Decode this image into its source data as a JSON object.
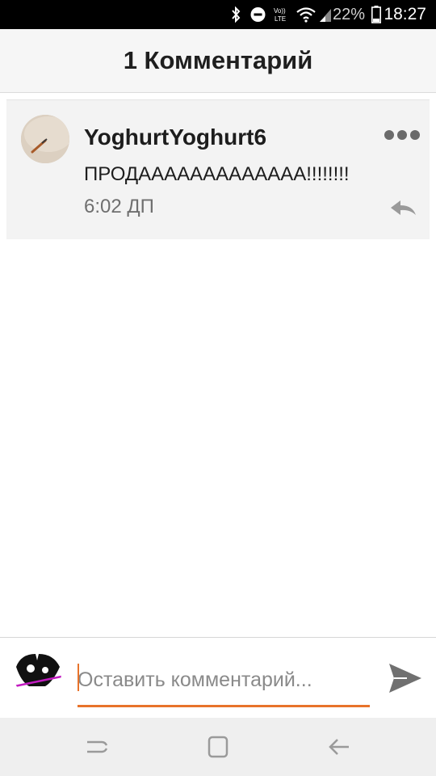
{
  "status_bar": {
    "battery_percent": "22%",
    "time": "18:27",
    "icons": [
      "bluetooth-icon",
      "do-not-disturb-icon",
      "volte-icon",
      "wifi-icon",
      "signal-icon",
      "battery-icon"
    ]
  },
  "header": {
    "title": "1 Комментарий"
  },
  "comments": [
    {
      "author": "YoghurtYoghurt6",
      "text": "ПРОДААААААААААААА!!!!!!!!",
      "time": "6:02 ДП"
    }
  ],
  "composer": {
    "placeholder": "Оставить комментарий..."
  },
  "colors": {
    "accent": "#e8732b",
    "card_bg": "#f3f3f3",
    "header_bg": "#f6f6f6",
    "nav_bg": "#efefef"
  },
  "nav_bar": {
    "icons": [
      "recent-apps-icon",
      "home-icon",
      "back-icon"
    ]
  }
}
